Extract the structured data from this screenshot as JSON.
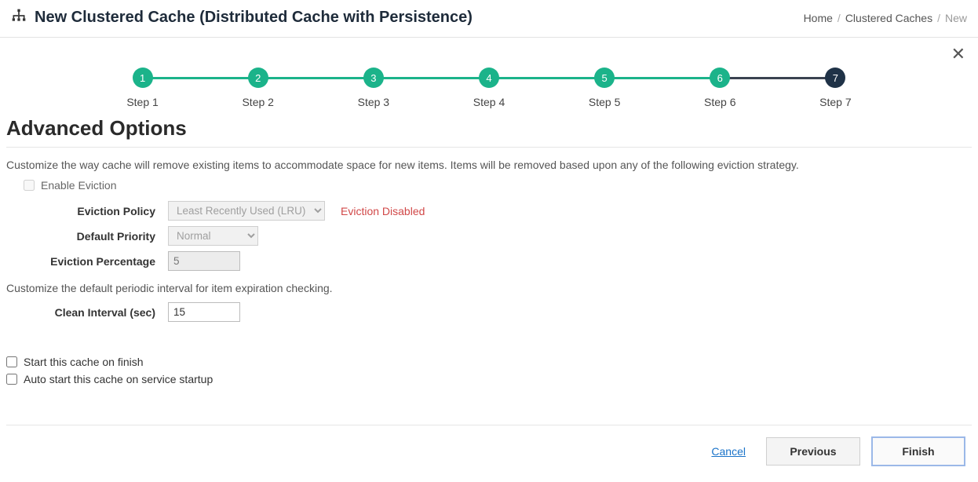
{
  "header": {
    "title": "New Clustered Cache (Distributed Cache with Persistence)"
  },
  "breadcrumb": {
    "home": "Home",
    "parent": "Clustered Caches",
    "current": "New"
  },
  "stepper": {
    "steps": [
      {
        "num": "1",
        "label": "Step 1"
      },
      {
        "num": "2",
        "label": "Step 2"
      },
      {
        "num": "3",
        "label": "Step 3"
      },
      {
        "num": "4",
        "label": "Step 4"
      },
      {
        "num": "5",
        "label": "Step 5"
      },
      {
        "num": "6",
        "label": "Step 6"
      },
      {
        "num": "7",
        "label": "Step 7"
      }
    ]
  },
  "section": {
    "title": "Advanced Options",
    "eviction_hint": "Customize the way cache will remove existing items to accommodate space for new items. Items will be removed based upon any of the following eviction strategy.",
    "enable_eviction_label": "Enable Eviction",
    "eviction_policy_label": "Eviction Policy",
    "eviction_policy_value": "Least Recently Used (LRU)",
    "eviction_disabled_warn": "Eviction Disabled",
    "default_priority_label": "Default Priority",
    "default_priority_value": "Normal",
    "eviction_pct_label": "Eviction Percentage",
    "eviction_pct_value": "5",
    "clean_hint": "Customize the default periodic interval for item expiration checking.",
    "clean_interval_label": "Clean Interval (sec)",
    "clean_interval_value": "15",
    "start_on_finish_label": "Start this cache on finish",
    "auto_start_label": "Auto start this cache on service startup"
  },
  "footer": {
    "cancel": "Cancel",
    "previous": "Previous",
    "finish": "Finish"
  }
}
